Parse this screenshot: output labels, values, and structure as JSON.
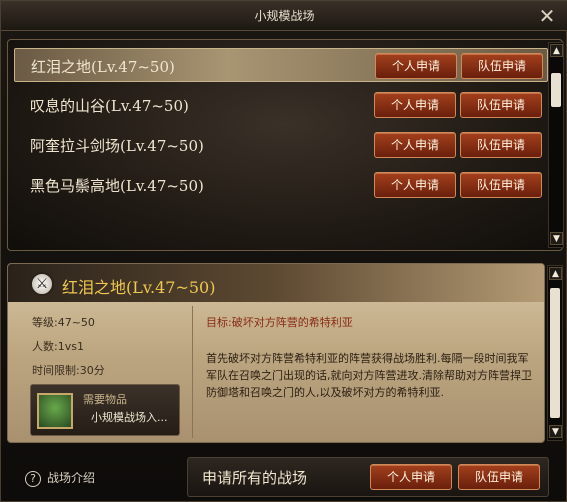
{
  "window": {
    "title": "小规模战场"
  },
  "battlefields": [
    {
      "label": "红泪之地(Lv.47~50)",
      "selected": true
    },
    {
      "label": "叹息的山谷(Lv.47~50)",
      "selected": false
    },
    {
      "label": "阿奎拉斗剑场(Lv.47~50)",
      "selected": false
    },
    {
      "label": "黑色马鬃高地(Lv.47~50)",
      "selected": false
    }
  ],
  "buttons": {
    "individual": "个人申请",
    "team": "队伍申请"
  },
  "detail": {
    "title": "红泪之地(Lv.47~50)",
    "level": "等级:47~50",
    "players": "人数:1vs1",
    "time_limit": "时间限制:30分",
    "required_label": "需要物品",
    "required_item": "小规模战场入...",
    "objective": "目标:破坏对方阵营的希特利亚",
    "description": "首先破坏对方阵营希特利亚的阵营获得战场胜利.每隔一段时间我军军队在召唤之门出现的话,就向对方阵营进攻.清除帮助对方阵营捍卫防御塔和召唤之门的人,以及破坏对方的希特利亚."
  },
  "footer": {
    "help_label": "战场介绍",
    "apply_all_label": "申请所有的战场"
  },
  "icons": {
    "close": "close-icon",
    "emblem": "crossed-swords-icon",
    "help": "question-icon",
    "item": "ticket-item-icon"
  },
  "colors": {
    "button_red": "#8a2e14",
    "title_gold": "#f0c850",
    "objective_red": "#8a2a14"
  }
}
